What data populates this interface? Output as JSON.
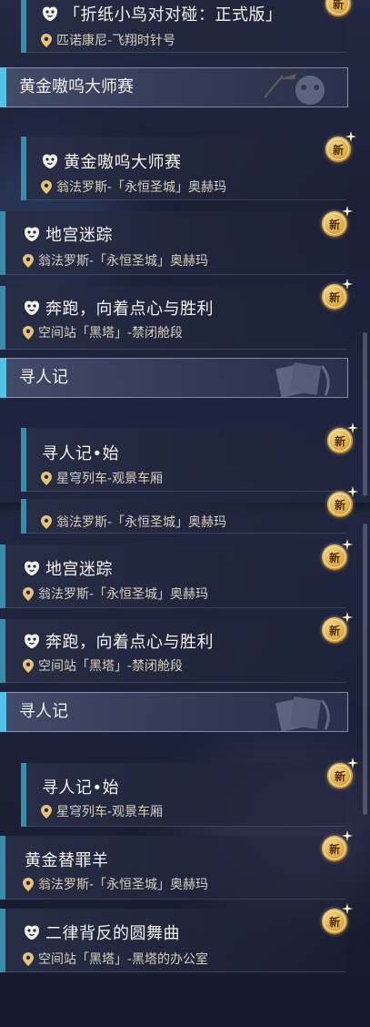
{
  "badge_new": "新",
  "first": {
    "item_origami": {
      "title": "「折纸小鸟对对碰：正式版」",
      "location": "匹诺康尼-飞翔时针号",
      "icon": "paw-icon"
    },
    "header_gold": {
      "label": "黄金嗷呜大师赛"
    },
    "item_gold_master": {
      "title": "黄金嗷呜大师赛",
      "location": "翁法罗斯-「永恒圣城」奥赫玛",
      "icon": "paw-icon"
    },
    "item_dungeon": {
      "title": "地宫迷踪",
      "location": "翁法罗斯-「永恒圣城」奥赫玛",
      "icon": "paw-icon"
    },
    "item_run": {
      "title": "奔跑，向着点心与胜利",
      "location": "空间站「黑塔」-禁闭舱段",
      "icon": "paw-icon"
    },
    "header_search": {
      "label": "寻人记"
    },
    "item_search_start": {
      "title": "寻人记•始",
      "location": "星穹列车-观景车厢"
    }
  },
  "second": {
    "item_partial": {
      "location": "翁法罗斯-「永恒圣城」奥赫玛"
    },
    "item_dungeon": {
      "title": "地宫迷踪",
      "location": "翁法罗斯-「永恒圣城」奥赫玛",
      "icon": "paw-icon"
    },
    "item_run": {
      "title": "奔跑，向着点心与胜利",
      "location": "空间站「黑塔」-禁闭舱段",
      "icon": "paw-icon"
    },
    "header_search": {
      "label": "寻人记"
    },
    "item_search_start": {
      "title": "寻人记•始",
      "location": "星穹列车-观景车厢"
    },
    "item_scapegoat": {
      "title": "黄金替罪羊",
      "location": "翁法罗斯-「永恒圣城」奥赫玛"
    },
    "item_waltz": {
      "title": "二律背反的圆舞曲",
      "location": "空间站「黑塔」-黑塔的办公室",
      "icon": "paw-icon"
    }
  },
  "colors": {
    "accent_bar": "#3a8cab",
    "header_accent": "#56c1e6",
    "badge_gold": "#d7a545"
  }
}
